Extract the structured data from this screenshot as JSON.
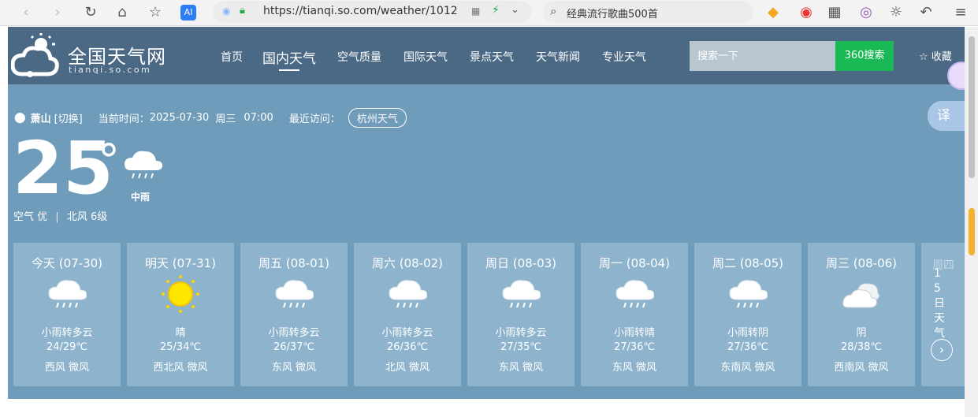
{
  "browser": {
    "url": "https://tianqi.so.com/weather/1012",
    "search_text": "经典流行歌曲500首",
    "ai_label": "AI"
  },
  "site": {
    "logo_title": "全国天气网",
    "logo_sub": "tianqi.so.com",
    "nav": [
      "首页",
      "国内天气",
      "空气质量",
      "国际天气",
      "景点天气",
      "天气新闻",
      "专业天气"
    ],
    "search_placeholder": "搜索一下",
    "search_btn": "360搜索",
    "favorite": "收藏"
  },
  "location": {
    "city": "萧山",
    "switch": "[切换]",
    "time_label": "当前时间：",
    "date": "2025-07-30",
    "weekday": "周三",
    "clock": "07:00",
    "recent_label": "最近访问：",
    "recent_city": "杭州天气"
  },
  "current": {
    "temp": "25",
    "deg": "°",
    "condition": "中雨",
    "air": "空气 优",
    "sep": "|",
    "wind": "北风 6级"
  },
  "translate": "译",
  "forecast": [
    {
      "day": "今天 (07-30)",
      "icon": "rain-icon",
      "cond": "小雨转多云",
      "temp": "24/29℃",
      "wind": "西风 微风"
    },
    {
      "day": "明天 (07-31)",
      "icon": "sun-icon",
      "cond": "晴",
      "temp": "25/34℃",
      "wind": "西北风 微风"
    },
    {
      "day": "周五 (08-01)",
      "icon": "rain-icon",
      "cond": "小雨转多云",
      "temp": "26/37℃",
      "wind": "东风 微风"
    },
    {
      "day": "周六 (08-02)",
      "icon": "rain-icon",
      "cond": "小雨转多云",
      "temp": "26/36℃",
      "wind": "北风 微风"
    },
    {
      "day": "周日 (08-03)",
      "icon": "rain-icon",
      "cond": "小雨转多云",
      "temp": "27/35℃",
      "wind": "东风 微风"
    },
    {
      "day": "周一 (08-04)",
      "icon": "rain-icon",
      "cond": "小雨转晴",
      "temp": "27/36℃",
      "wind": "东风 微风"
    },
    {
      "day": "周二 (08-05)",
      "icon": "rain-icon",
      "cond": "小雨转阴",
      "temp": "27/36℃",
      "wind": "东南风 微风"
    },
    {
      "day": "周三 (08-06)",
      "icon": "cloud-icon",
      "cond": "阴",
      "temp": "28/38℃",
      "wind": "西南风 微风"
    }
  ],
  "more": {
    "label": "15日天气",
    "peek": "周四"
  }
}
